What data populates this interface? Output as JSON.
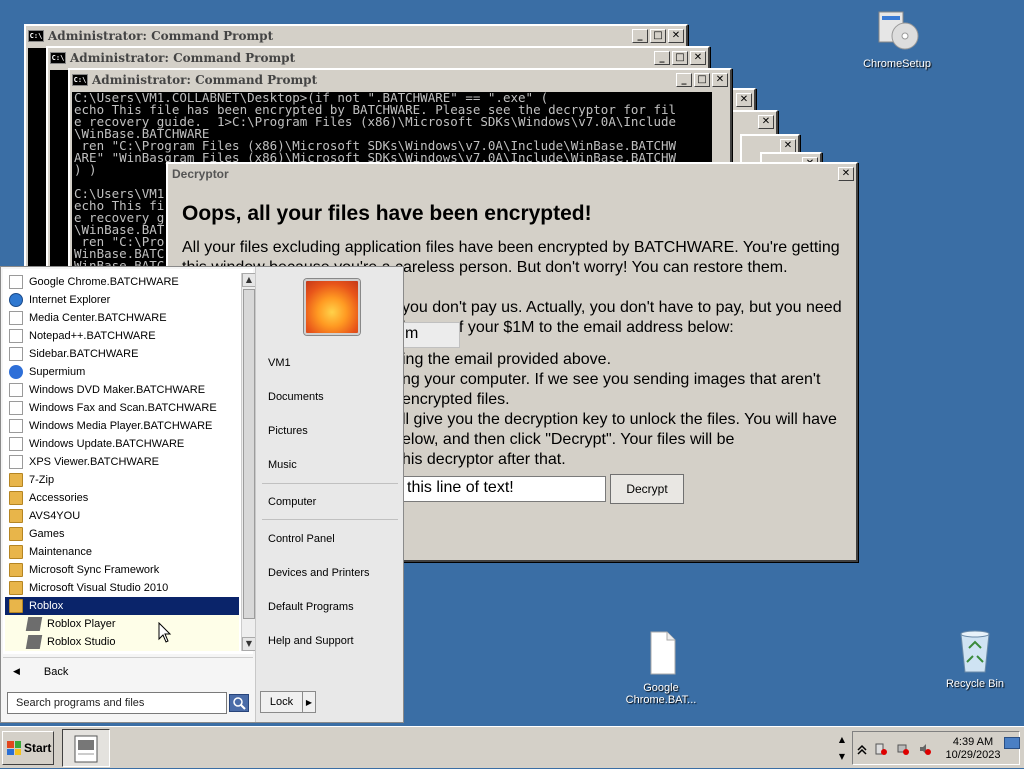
{
  "desktop": {
    "icons": [
      {
        "label": "ChromeSetup"
      },
      {
        "label": "Google Chrome.BAT..."
      },
      {
        "label": "Recycle Bin"
      }
    ]
  },
  "cmd_windows": [
    {
      "title": "Administrator: Command Prompt"
    },
    {
      "title": "Administrator: Command Prompt"
    },
    {
      "title": "Administrator: Command Prompt",
      "lines": [
        "C:\\Users\\VM1.COLLABNET\\Desktop>(if not \".BATCHWARE\" == \".exe\" (",
        "echo This file has been encrypted by BATCHWARE. Please see the decryptor for fil",
        "e recovery guide.  1>C:\\Program Files (x86)\\Microsoft SDKs\\Windows\\v7.0A\\Include",
        "\\WinBase.BATCHWARE",
        " ren \"C:\\Program Files (x86)\\Microsoft SDKs\\Windows\\v7.0A\\Include\\WinBase.BATCHW",
        "ARE\" \"WinBasgram Files (x86)\\Microsoft SDKs\\Windows\\v7.0A\\Include\\WinBase.BATCHW",
        ") )",
        "",
        "C:\\Users\\VM1",
        "echo This fi",
        "e recovery g",
        "\\WinBase.BAT",
        " ren \"C:\\Pro",
        "WinBase.BATC",
        "WinBase.BATC"
      ]
    }
  ],
  "decryptor": {
    "title": "Decryptor",
    "close": "✕",
    "heading": "Oops, all your files have been encrypted!",
    "para1_line1": "All your files excluding application files have been encrypted by BATCHWARE. You're getting",
    "para1_line2": "this window because you're a careless person. But don't worry! You can restore them. However,",
    "para1_line3": "you don't pay us. Actually, you don't have to pay, but you need",
    "para1_line4": "image of your $1M to the email address below:",
    "email_fragment": "m",
    "line_a": "ing the email provided above.",
    "line_b": "ng your computer. If we see you sending images that aren't",
    "line_c": "encrypted files.",
    "line_d": "ll give you the decryption key to unlock the files. You will have",
    "line_e": "elow, and then click \"Decrypt\". Your files will be",
    "line_f": "his decryptor after that.",
    "key_input_value": "this line of text!",
    "decrypt_button": "Decrypt"
  },
  "start_menu": {
    "programs": [
      {
        "label": "Google Chrome.BATCHWARE",
        "icon": "file-icon"
      },
      {
        "label": "Internet Explorer",
        "icon": "internet-explorer-icon"
      },
      {
        "label": "Media Center.BATCHWARE",
        "icon": "file-icon"
      },
      {
        "label": "Notepad++.BATCHWARE",
        "icon": "file-icon"
      },
      {
        "label": "Sidebar.BATCHWARE",
        "icon": "file-icon"
      },
      {
        "label": "Supermium",
        "icon": "supermium-icon"
      },
      {
        "label": "Windows DVD Maker.BATCHWARE",
        "icon": "file-icon"
      },
      {
        "label": "Windows Fax and Scan.BATCHWARE",
        "icon": "file-icon"
      },
      {
        "label": "Windows Media Player.BATCHWARE",
        "icon": "file-icon"
      },
      {
        "label": "Windows Update.BATCHWARE",
        "icon": "file-icon"
      },
      {
        "label": "XPS Viewer.BATCHWARE",
        "icon": "file-icon"
      },
      {
        "label": "7-Zip",
        "icon": "folder-icon"
      },
      {
        "label": "Accessories",
        "icon": "folder-icon"
      },
      {
        "label": "AVS4YOU",
        "icon": "folder-icon"
      },
      {
        "label": "Games",
        "icon": "folder-icon"
      },
      {
        "label": "Maintenance",
        "icon": "folder-icon"
      },
      {
        "label": "Microsoft Sync Framework",
        "icon": "folder-icon"
      },
      {
        "label": "Microsoft Visual Studio 2010",
        "icon": "folder-icon"
      },
      {
        "label": "Roblox",
        "icon": "folder-icon",
        "selected": true
      },
      {
        "label": "Roblox Player",
        "icon": "roblox-icon",
        "sub": true
      },
      {
        "label": "Roblox Studio",
        "icon": "roblox-studio-icon",
        "sub": true
      }
    ],
    "back": "Back",
    "search_placeholder": "Search programs and files",
    "right_links": [
      "VM1",
      "Documents",
      "Pictures",
      "Music",
      "Computer",
      "Control Panel",
      "Devices and Printers",
      "Default Programs",
      "Help and Support"
    ],
    "lock": "Lock"
  },
  "taskbar": {
    "start": "Start",
    "time": "4:39 AM",
    "date": "10/29/2023"
  }
}
